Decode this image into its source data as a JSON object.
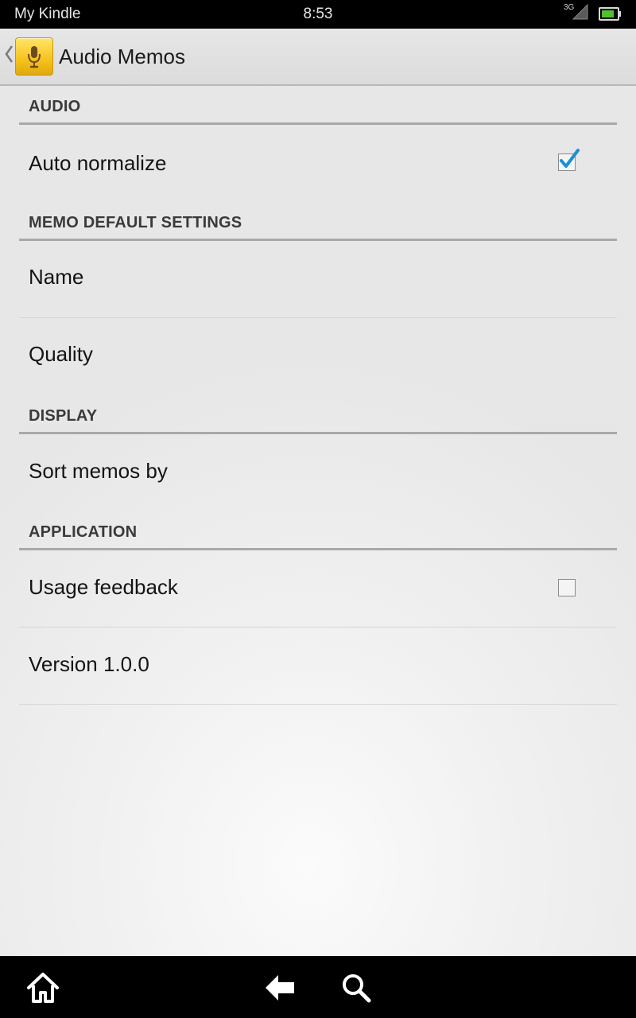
{
  "status_bar": {
    "device_name": "My Kindle",
    "time": "8:53",
    "network": "3G"
  },
  "action_bar": {
    "title": "Audio Memos"
  },
  "sections": [
    {
      "header": "AUDIO",
      "items": [
        {
          "label": "Auto normalize",
          "checkbox": true,
          "checked": true
        }
      ]
    },
    {
      "header": "MEMO DEFAULT SETTINGS",
      "items": [
        {
          "label": "Name"
        },
        {
          "label": "Quality"
        }
      ]
    },
    {
      "header": "DISPLAY",
      "items": [
        {
          "label": "Sort memos by"
        }
      ]
    },
    {
      "header": "APPLICATION",
      "items": [
        {
          "label": "Usage feedback",
          "checkbox": true,
          "checked": false
        },
        {
          "label": "Version 1.0.0"
        }
      ]
    }
  ],
  "nav_bar": {
    "icons": [
      "home-icon",
      "back-arrow-icon",
      "search-icon"
    ]
  },
  "colors": {
    "checkmark": "#1a8fd6",
    "app_icon": "#f6c21b"
  }
}
